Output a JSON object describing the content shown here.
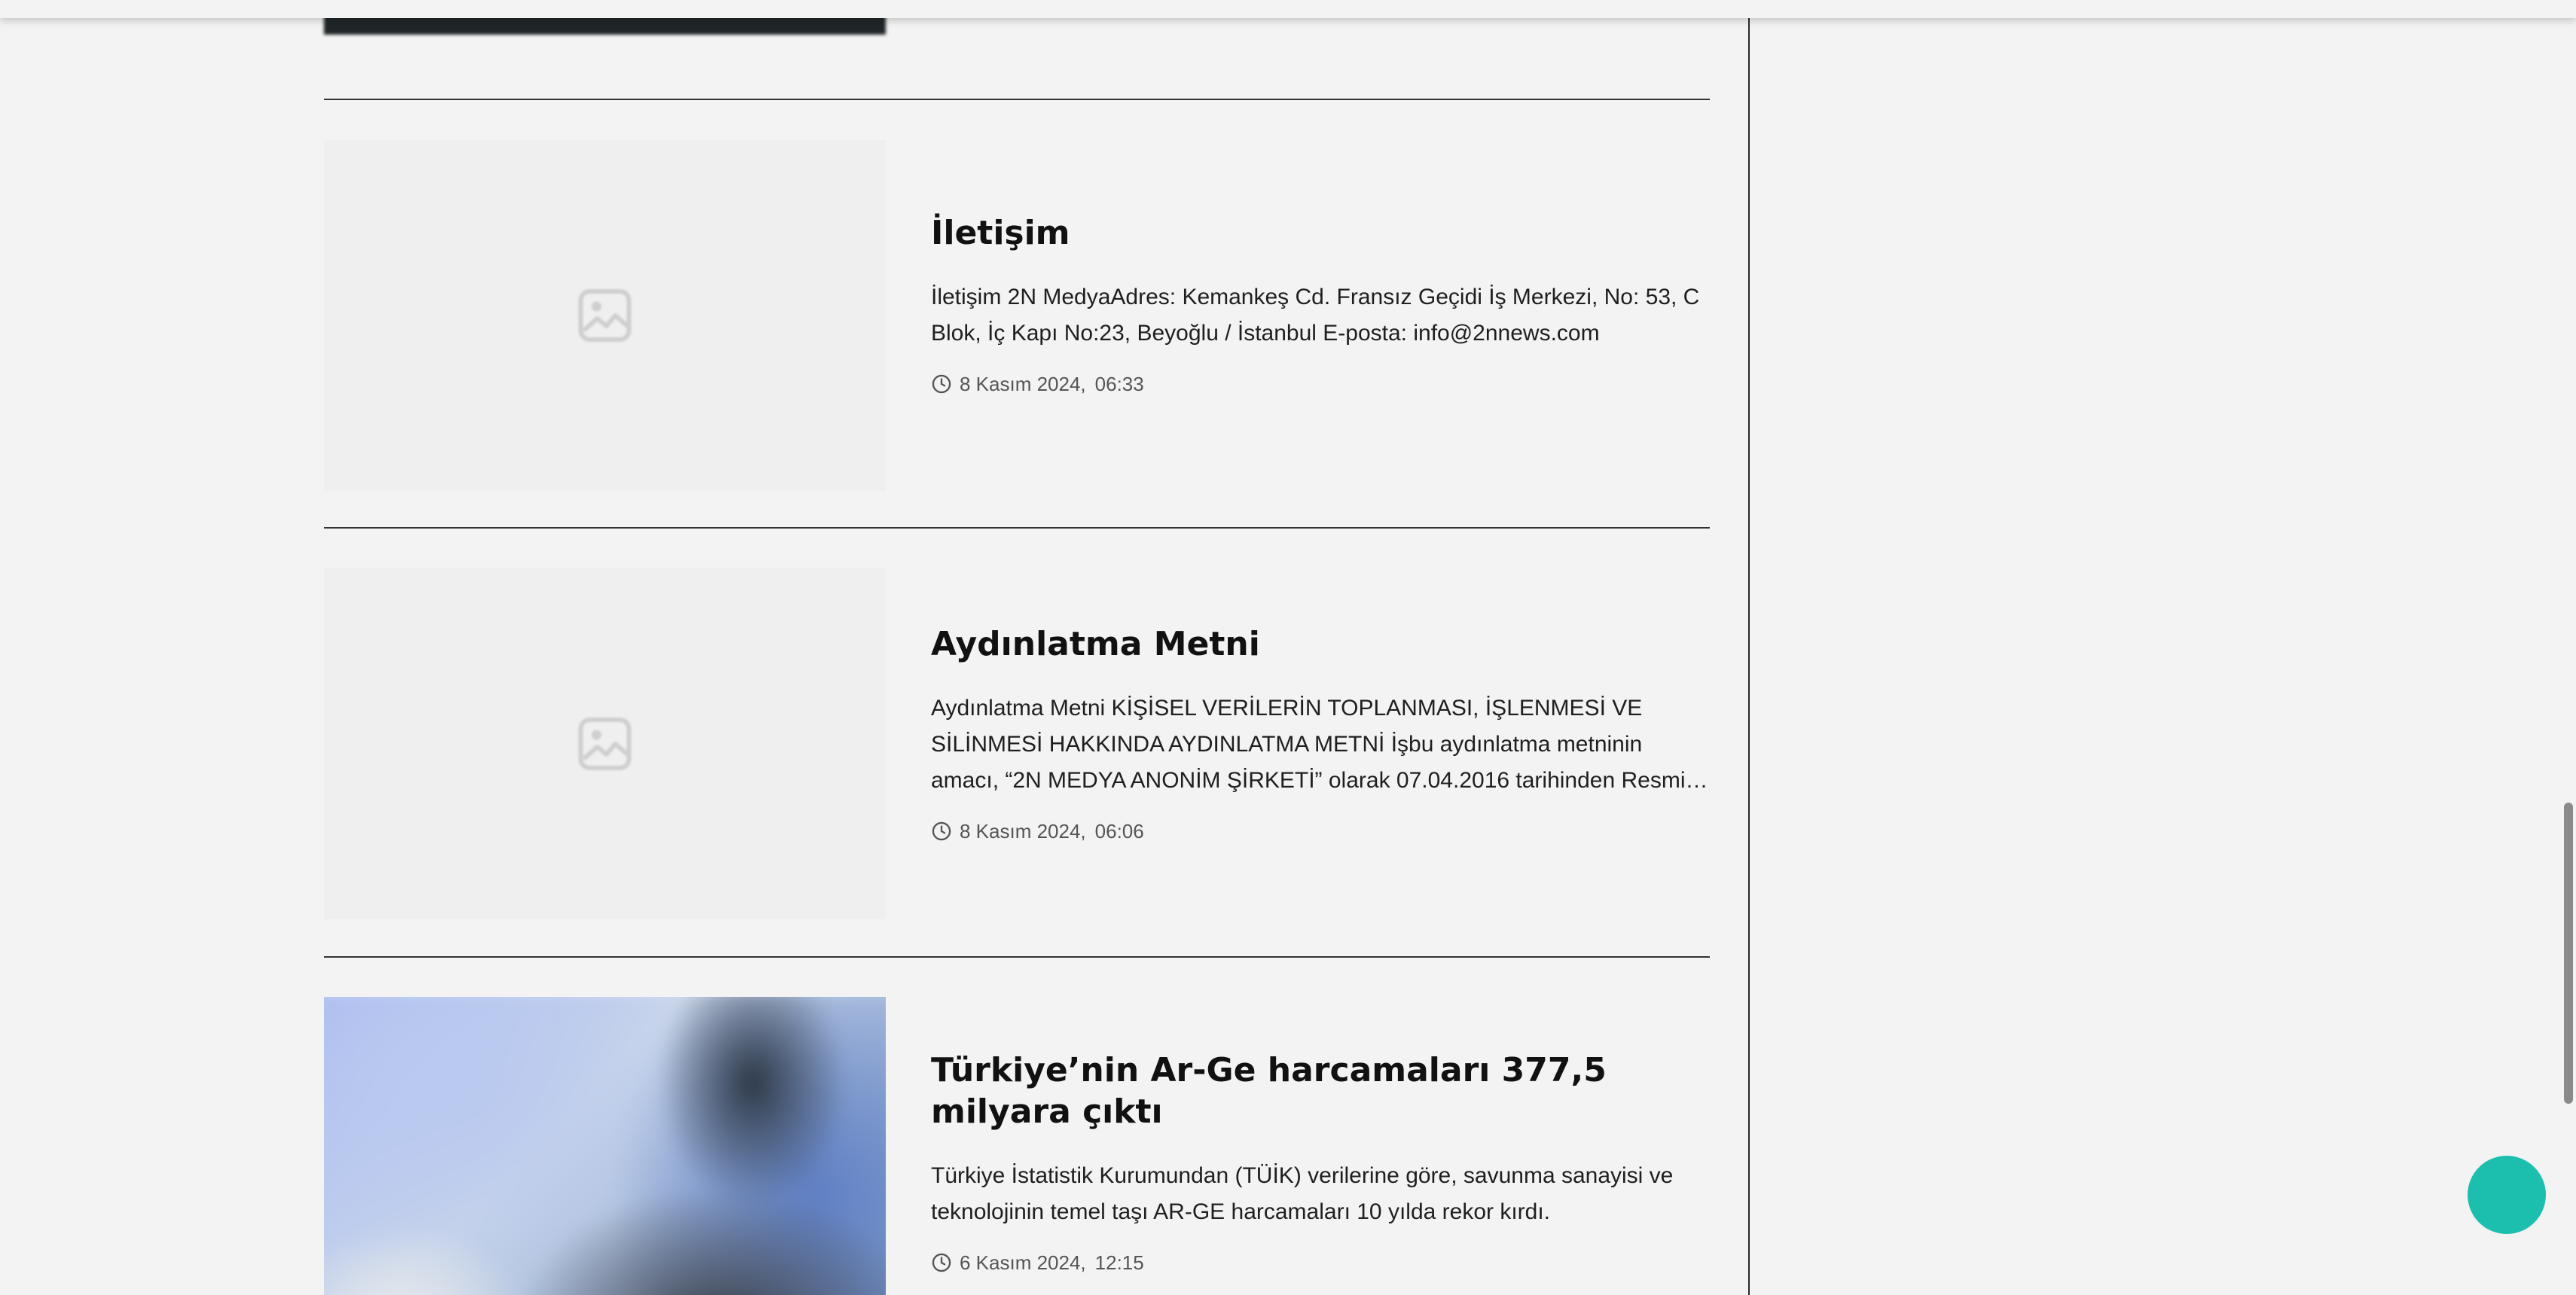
{
  "articles": [
    {
      "title": "",
      "excerpt": "",
      "date": "",
      "time": ""
    },
    {
      "title": "İletişim",
      "excerpt": "İletişim 2N MedyaAdres: Kemankeş Cd. Fransız Geçidi İş Merkezi, No: 53, C Blok, İç Kapı No:23, Beyoğlu / İstanbul E-posta: info@2nnews.com",
      "date": "8 Kasım 2024,",
      "time": "06:33",
      "thumbnail": "image-placeholder-icon"
    },
    {
      "title": "Aydınlatma Metni",
      "excerpt": "Aydınlatma Metni KİŞİSEL VERİLERİN TOPLANMASI, İŞLENMESİ VE SİLİNMESİ HAKKINDA AYDINLATMA METNİ İşbu aydınlatma metninin amacı, “2N MEDYA ANONİM ŞİRKETİ” olarak 07.04.2016 tarihinden Resmi…",
      "date": "8 Kasım 2024,",
      "time": "06:06",
      "thumbnail": "image-placeholder-icon"
    },
    {
      "title": "Türkiye’nin Ar-Ge harcamaları 377,5 milyara çıktı",
      "excerpt": "Türkiye İstatistik Kurumundan (TÜİK) verilerine göre, savunma sanayisi ve teknolojinin temel taşı AR-GE harcamaları 10 yılda rekor kırdı.",
      "date": "6 Kasım 2024,",
      "time": "12:15",
      "thumbnail": "photo"
    }
  ],
  "icons": {
    "clock": "clock-icon",
    "placeholder": "image-placeholder-icon"
  },
  "colors": {
    "background": "#f3f3f3",
    "chat_button": "#1cbfae",
    "divider": "#333333",
    "meta_text": "#555555"
  }
}
